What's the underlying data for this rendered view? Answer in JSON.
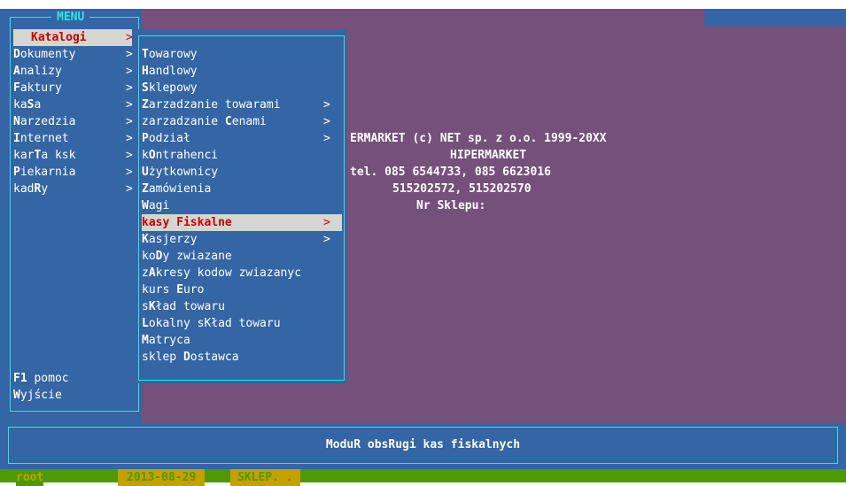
{
  "menu": {
    "title": "MENU",
    "items": [
      {
        "hotkey": "Katalogi",
        "rest": "",
        "arrow": ">",
        "selected": true
      },
      {
        "hotkey": "D",
        "rest": "okumenty",
        "arrow": ">"
      },
      {
        "hotkey": "A",
        "rest": "nalizy",
        "arrow": ">"
      },
      {
        "hotkey": "F",
        "rest": "aktury",
        "arrow": ">"
      },
      {
        "pre": "ka",
        "hotkey": "S",
        "rest": "a",
        "arrow": ">"
      },
      {
        "hotkey": "N",
        "rest": "arzedzia",
        "arrow": ">"
      },
      {
        "hotkey": "I",
        "rest": "nternet",
        "arrow": ">"
      },
      {
        "pre": "kar",
        "hotkey": "T",
        "rest": "a ksk",
        "arrow": ">"
      },
      {
        "hotkey": "P",
        "rest": "iekarnia",
        "arrow": ">"
      },
      {
        "pre": "kad",
        "hotkey": "R",
        "rest": "y",
        "arrow": ">"
      }
    ],
    "help": {
      "hotkey": "F1",
      "rest": " pomoc"
    },
    "exit": {
      "hotkey": "W",
      "rest": "yjście"
    }
  },
  "submenu": {
    "items": [
      {
        "hotkey": "T",
        "rest": "owarowy"
      },
      {
        "hotkey": "H",
        "rest": "andlowy"
      },
      {
        "hotkey": "S",
        "rest": "klepowy"
      },
      {
        "hotkey": "Z",
        "rest": "arzadzanie towarami",
        "arrow": ">"
      },
      {
        "pre": "zarzadzanie ",
        "hotkey": "C",
        "rest": "enami",
        "arrow": ">"
      },
      {
        "hotkey": "P",
        "rest": "odział",
        "arrow": ">"
      },
      {
        "pre": "k",
        "hotkey": "O",
        "rest": "ntrahenci"
      },
      {
        "hotkey": "U",
        "rest": "żytkownicy"
      },
      {
        "hotkey": "Z",
        "rest": "amówienia"
      },
      {
        "hotkey": "W",
        "rest": "agi"
      },
      {
        "pre": "kasy Fiskalne",
        "hotkey": "",
        "rest": "",
        "arrow": ">",
        "selected": true
      },
      {
        "hotkey": "K",
        "rest": "asjerzy",
        "arrow": ">"
      },
      {
        "pre": "ko",
        "hotkey": "D",
        "rest": "y zwiazane"
      },
      {
        "pre": "z",
        "hotkey": "A",
        "rest": "kresy kodow zwiazanyc"
      },
      {
        "pre": "kurs ",
        "hotkey": "E",
        "rest": "uro"
      },
      {
        "pre": "s",
        "hotkey": "K",
        "rest": "ład towaru"
      },
      {
        "hotkey": "L",
        "rest": "okalny sKład towaru"
      },
      {
        "hotkey": "M",
        "rest": "atryca"
      },
      {
        "pre": "sklep ",
        "hotkey": "D",
        "rest": "ostawca"
      }
    ]
  },
  "info": {
    "line1": "ERMARKET (c) NET sp. z o.o. 1999-20XX",
    "line2": "HIPERMARKET",
    "line3": "tel. 085 6544733, 085 6623016",
    "line4": "515202572, 515202570",
    "line5": "Nr Sklepu:"
  },
  "footer": {
    "text": "ModuR obsRugi kas fiskalnych"
  },
  "status": {
    "user": "root",
    "date": "2013-08-29",
    "shop": "SKLEP. ."
  }
}
